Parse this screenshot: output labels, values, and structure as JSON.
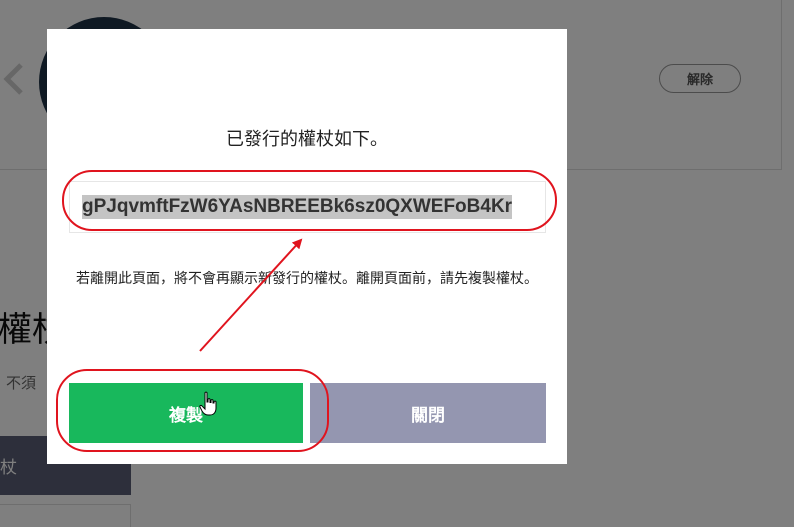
{
  "background": {
    "remove_label": "解除",
    "heading": "權杖",
    "description": "不須",
    "issue_button_label": "杖"
  },
  "modal": {
    "title": "已發行的權杖如下。",
    "token": "gPJqvmftFzW6YAsNBREEBk6sz0QXWEFoB4Kr",
    "warning": "若離開此頁面，將不會再顯示新發行的權杖。離開頁面前，請先複製權杖。",
    "copy_label": "複製",
    "close_label": "關閉"
  },
  "colors": {
    "copy_button": "#18b85c",
    "close_button": "#9496b0",
    "annotation": "#e0141e"
  },
  "icons": {
    "cursor": "hand-pointer-icon",
    "back": "chevron-left-icon"
  }
}
